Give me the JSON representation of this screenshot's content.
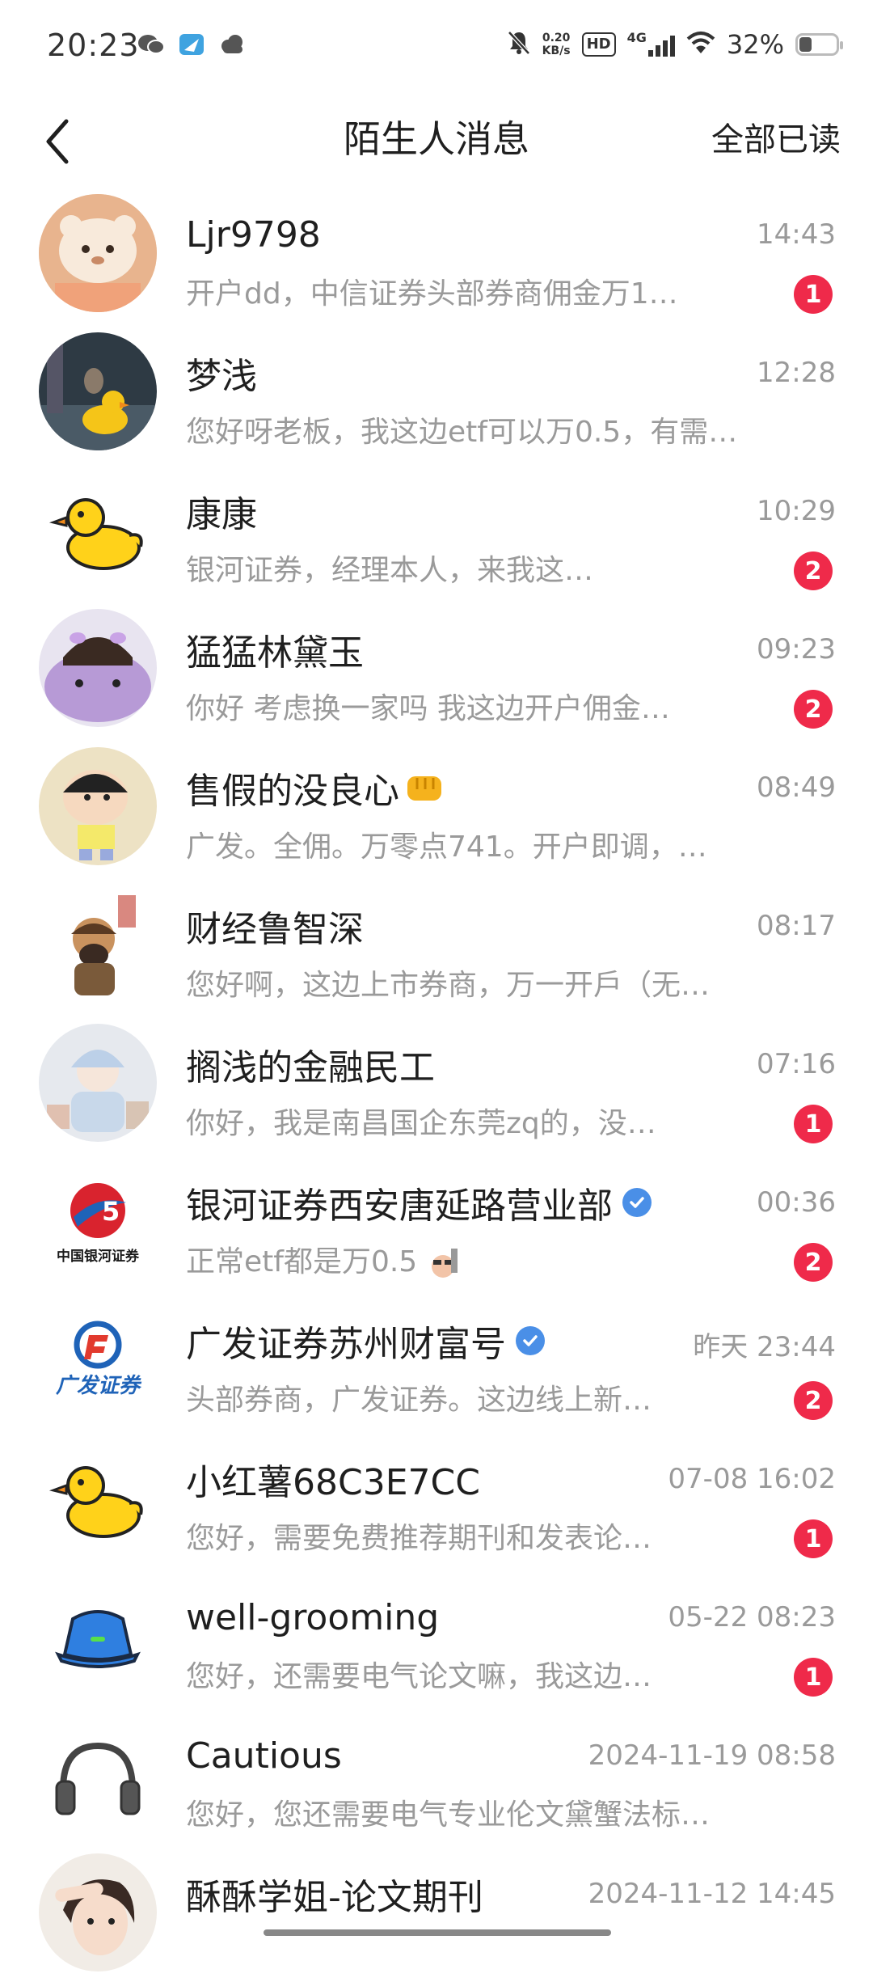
{
  "status_bar": {
    "time": "20:23",
    "net_speed_value": "0.20",
    "net_speed_unit": "KB/s",
    "hd": "HD",
    "network": "4G",
    "battery_percent": "32%",
    "battery_level": 0.32
  },
  "header": {
    "title": "陌生人消息",
    "read_all": "全部已读"
  },
  "messages": [
    {
      "name": "Ljr9798",
      "time": "14:43",
      "preview": "开户dd，中信证券头部券商佣金万1…",
      "badge": "1"
    },
    {
      "name": "梦浅",
      "time": "12:28",
      "preview": "您好呀老板，我这边etf可以万0.5，有需…",
      "badge": ""
    },
    {
      "name": "康康",
      "time": "10:29",
      "preview": "银河证券，经理本人，来我这…",
      "badge": "2"
    },
    {
      "name": "猛猛林黛玉",
      "time": "09:23",
      "preview": "你好 考虑换一家吗 我这边开户佣金…",
      "badge": "2"
    },
    {
      "name": "售假的没良心",
      "time": "08:49",
      "preview": "广发。全佣。万零点741。开户即调，…",
      "badge": ""
    },
    {
      "name": "财经鲁智深",
      "time": "08:17",
      "preview": "您好啊，这边上市券商，万一开戶（无…",
      "badge": ""
    },
    {
      "name": "搁浅的金融民工",
      "time": "07:16",
      "preview": "你好，我是南昌国企东莞zq的，没…",
      "badge": "1"
    },
    {
      "name": "银河证券西安唐延路营业部",
      "time": "00:36",
      "preview": "正常etf都是万0.5",
      "badge": "2",
      "avatar_text": "中国银河证券"
    },
    {
      "name": "广发证券苏州财富号",
      "time": "昨天 23:44",
      "preview": "头部券商，广发证券。这边线上新…",
      "badge": "2",
      "avatar_text": "广发证券"
    },
    {
      "name": "小红薯68C3E7CC",
      "time": "07-08 16:02",
      "preview": "您好，需要免费推荐期刊和发表论…",
      "badge": "1"
    },
    {
      "name": "well-grooming",
      "time": "05-22 08:23",
      "preview": "您好，还需要电气论文嘛，我这边…",
      "badge": "1"
    },
    {
      "name": "Cautious",
      "time": "2024-11-19 08:58",
      "preview": "您好，您还需要电气专业伦文黛蟹法标…",
      "badge": ""
    },
    {
      "name": "酥酥学姐-论文期刊",
      "time": "2024-11-12 14:45",
      "preview": "",
      "badge": ""
    }
  ],
  "colors": {
    "badge": "#ef2a4a",
    "verified": "#4a8fe7",
    "secondary_text": "#9a9a9a"
  }
}
